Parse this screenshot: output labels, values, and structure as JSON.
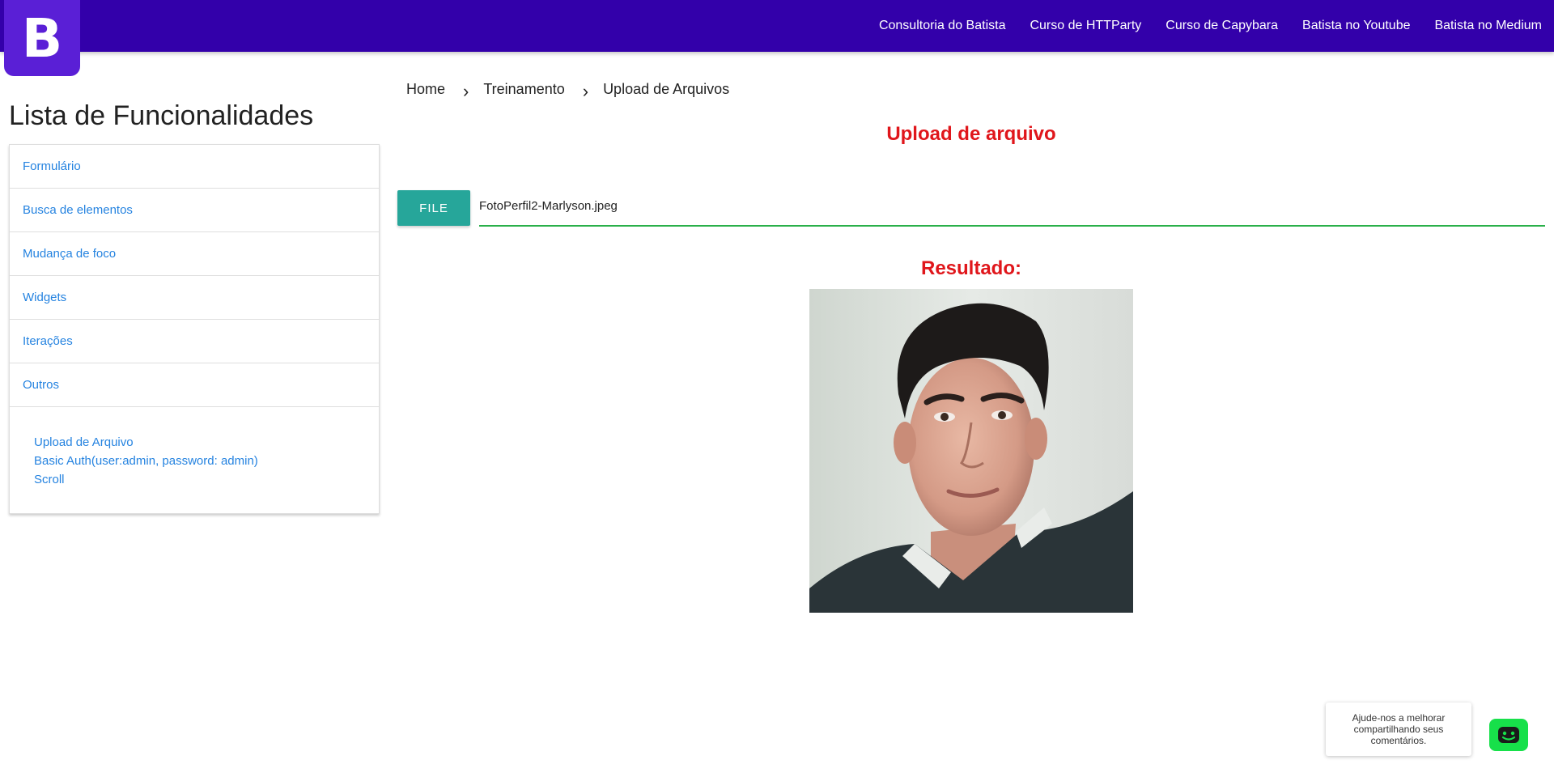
{
  "header": {
    "logo_letter": "B",
    "nav": [
      "Consultoria do Batista",
      "Curso de HTTParty",
      "Curso de Capybara",
      "Batista no Youtube",
      "Batista no Medium"
    ],
    "bar_color": "#3300aa"
  },
  "sidebar": {
    "title": "Lista de Funcionalidades",
    "items": [
      "Formulário",
      "Busca de elementos",
      "Mudança de foco",
      "Widgets",
      "Iterações",
      "Outros"
    ],
    "sub_items": [
      "Upload de Arquivo",
      "Basic Auth(user:admin, password: admin)",
      "Scroll"
    ],
    "link_color": "#2583e0"
  },
  "breadcrumb": {
    "items": [
      "Home",
      "Treinamento",
      "Upload de Arquivos"
    ],
    "separator": "›"
  },
  "main": {
    "title": "Upload de arquivo",
    "file_button": "FILE",
    "file_path": "FotoPerfil2-Marlyson.jpeg",
    "result_title": "Resultado:",
    "accent_color": "#e0161b",
    "button_color": "#26a69a"
  },
  "feedback": {
    "text": "Ajude-nos a melhorar compartilhando seus comentários.",
    "icon": "smiley-chat-icon",
    "color": "#17e04a"
  }
}
